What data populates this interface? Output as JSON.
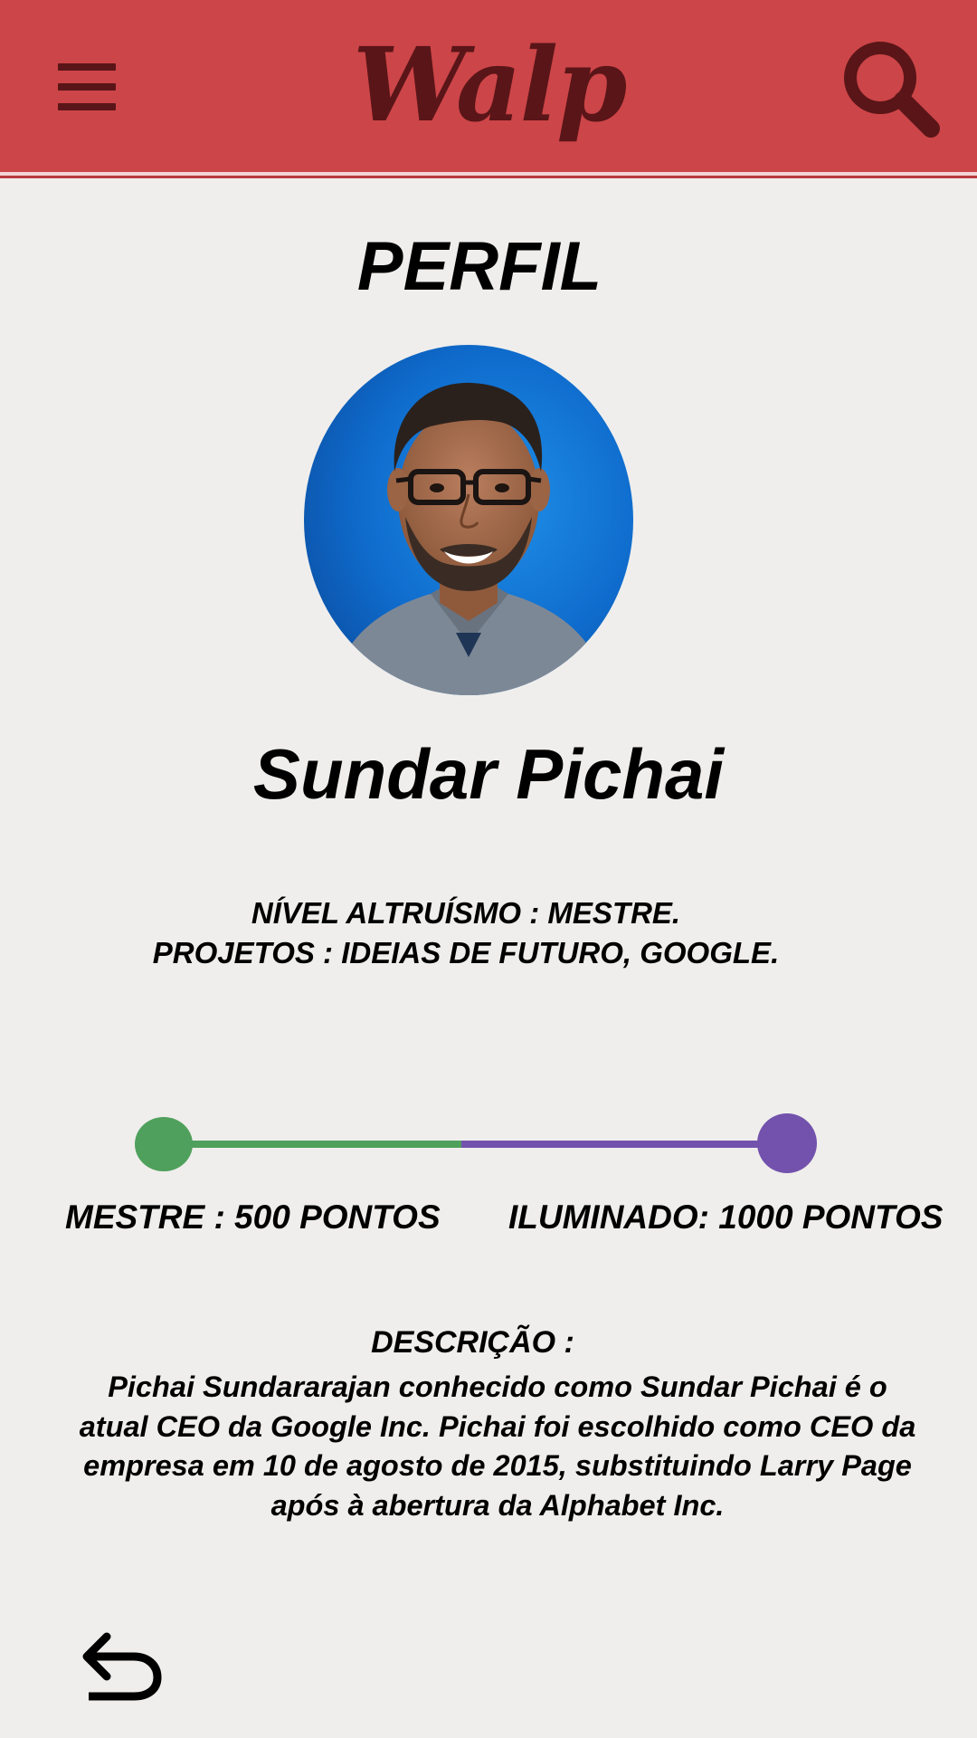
{
  "app": {
    "brand": "Walp",
    "header_color": "#cc4548",
    "icon_color": "#5a1518",
    "menu_icon": "hamburger-menu-icon",
    "search_icon": "search-icon",
    "back_icon": "back-arrow-icon"
  },
  "profile": {
    "page_title": "PERFIL",
    "name": "Sundar Pichai",
    "info_lines": [
      "NÍVEL ALTRUÍSMO : MESTRE.",
      "PROJETOS : IDEIAS DE FUTURO, GOOGLE."
    ]
  },
  "progress": {
    "current_level_label": "MESTRE : 500 PONTOS",
    "next_level_label": "ILUMINADO: 1000 PONTOS",
    "current_points": 500,
    "next_points": 1000,
    "progress_fraction": 0.5,
    "current_color": "#4fa05c",
    "next_color": "#7352ad"
  },
  "description": {
    "title": "DESCRIÇÃO :",
    "text": "Pichai Sundararajan conhecido como Sundar Pichai é o atual CEO da Google Inc. Pichai foi escolhido como CEO da empresa em 10 de agosto de 2015, substituindo Larry Page após à abertura da Alphabet Inc."
  }
}
